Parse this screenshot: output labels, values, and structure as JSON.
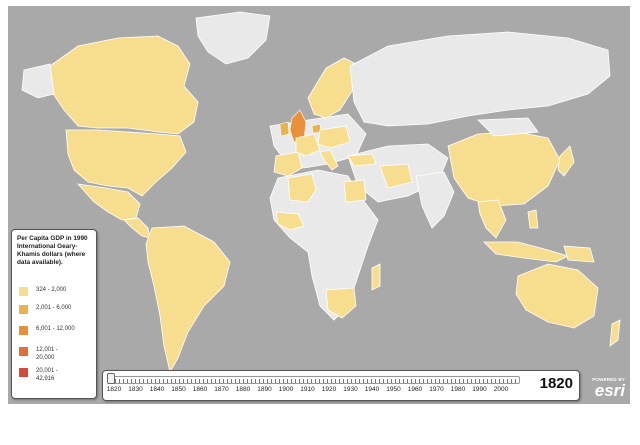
{
  "map": {
    "colors": {
      "ocean": "#a9a9a9",
      "no_data_land": "#e9e9e9",
      "class_324_2000": "#f7de8e",
      "class_2001_6000": "#e8b24c",
      "class_6001_12000": "#e8913a",
      "class_12001_20000": "#e0703a",
      "class_20001_42916": "#d64a3a"
    }
  },
  "legend": {
    "title": "Per Capita GDP in 1990 International Geary-Khamis dollars (where data available).",
    "items": [
      {
        "label": "324 - 2,000",
        "color": "#f7de8e"
      },
      {
        "label": "2,001 - 6,000",
        "color": "#e8b24c"
      },
      {
        "label": "6,001 - 12,000",
        "color": "#e8913a"
      },
      {
        "label": "12,001 - 20,000",
        "color": "#e0703a"
      },
      {
        "label": "20,001 - 42,916",
        "color": "#d64a3a"
      }
    ]
  },
  "timeline": {
    "ticks": [
      "1820",
      "1830",
      "1840",
      "1850",
      "1860",
      "1870",
      "1880",
      "1890",
      "1900",
      "1910",
      "1920",
      "1930",
      "1940",
      "1950",
      "1960",
      "1970",
      "1980",
      "1990",
      "2000"
    ],
    "current_year": "1820",
    "slider_position_fraction": 0.0
  },
  "branding": {
    "powered_by": "POWERED BY",
    "logo_text": "esri"
  }
}
